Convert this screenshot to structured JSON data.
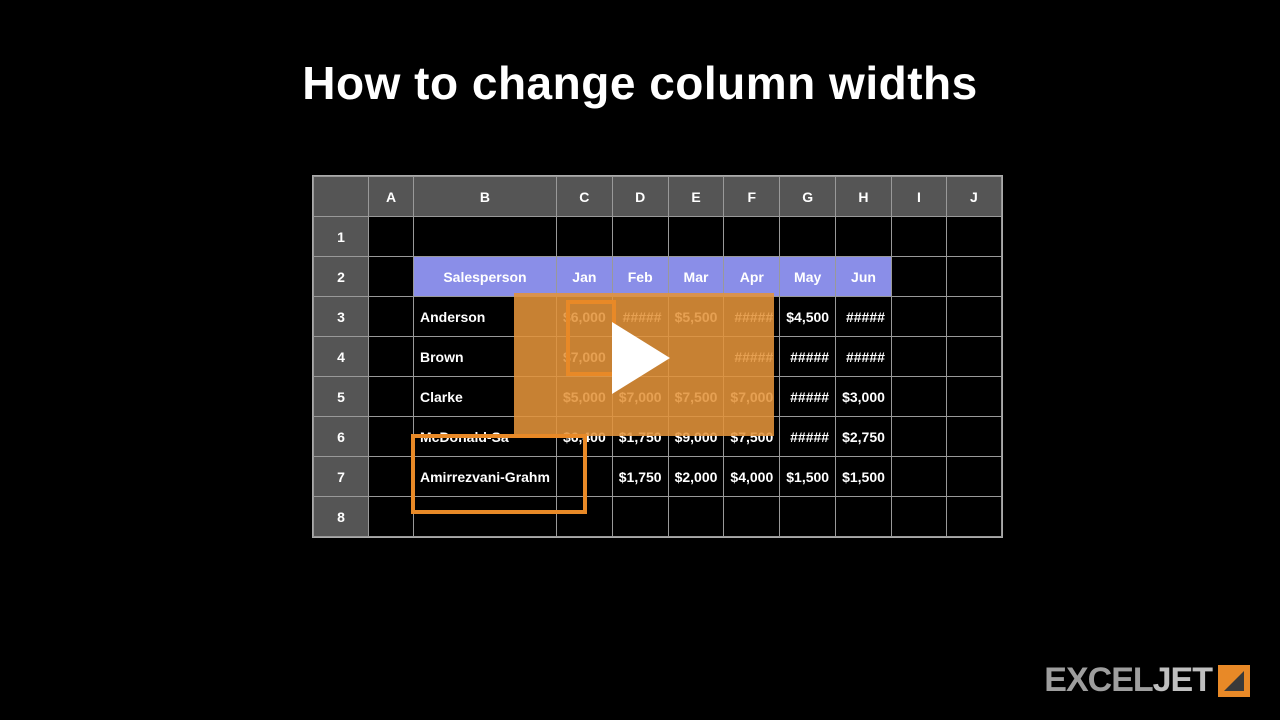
{
  "title": "How to change column widths",
  "columns": [
    "A",
    "B",
    "C",
    "D",
    "E",
    "F",
    "G",
    "H",
    "I",
    "J"
  ],
  "rows": [
    "1",
    "2",
    "3",
    "4",
    "5",
    "6",
    "7",
    "8"
  ],
  "header": {
    "sales": "Salesperson",
    "months": [
      "Jan",
      "Feb",
      "Mar",
      "Apr",
      "May",
      "Jun"
    ]
  },
  "data": [
    {
      "name": "Anderson",
      "vals": [
        "$6,000",
        "#####",
        "$5,500",
        "#####",
        "$4,500",
        "#####"
      ]
    },
    {
      "name": "Brown",
      "vals": [
        "$7,000",
        "#####",
        "",
        "#####",
        "#####",
        "#####"
      ]
    },
    {
      "name": "Clarke",
      "vals": [
        "$5,000",
        "$7,000",
        "$7,500",
        "$7,000",
        "#####",
        "$3,000"
      ]
    },
    {
      "name": "McDonald-Sa",
      "vals": [
        "$6,400",
        "$1,750",
        "$9,000",
        "$7,500",
        "#####",
        "$2,750"
      ]
    },
    {
      "name": "Amirrezvani-Grahm",
      "vals": [
        "",
        "$1,750",
        "$2,000",
        "$4,000",
        "$1,500",
        "$1,500"
      ]
    }
  ],
  "logo": {
    "brand1": "EXCEL",
    "brand2": "JET"
  }
}
